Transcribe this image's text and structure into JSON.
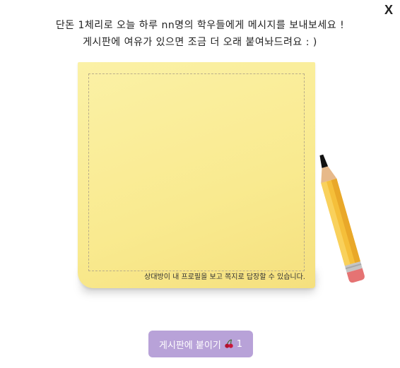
{
  "dialog": {
    "close_label": "X"
  },
  "header": {
    "line1": "단돈 1체리로 오늘 하루 nn명의 학우들에게 메시지를 보내보세요 !",
    "line2": "게시판에 여유가 있으면 조금 더 오래 붙여놔드려요 : )"
  },
  "note": {
    "message_value": "",
    "hint": "상대방이 내 프로필을 보고 쪽지로 답장할 수 있습니다.",
    "color": "#f9ea8f"
  },
  "pencil": {
    "icon": "pencil-icon"
  },
  "submit": {
    "label": "게시판에 붙이기",
    "icon": "cherry-icon",
    "count": "1",
    "color": "#b8a2d8"
  }
}
